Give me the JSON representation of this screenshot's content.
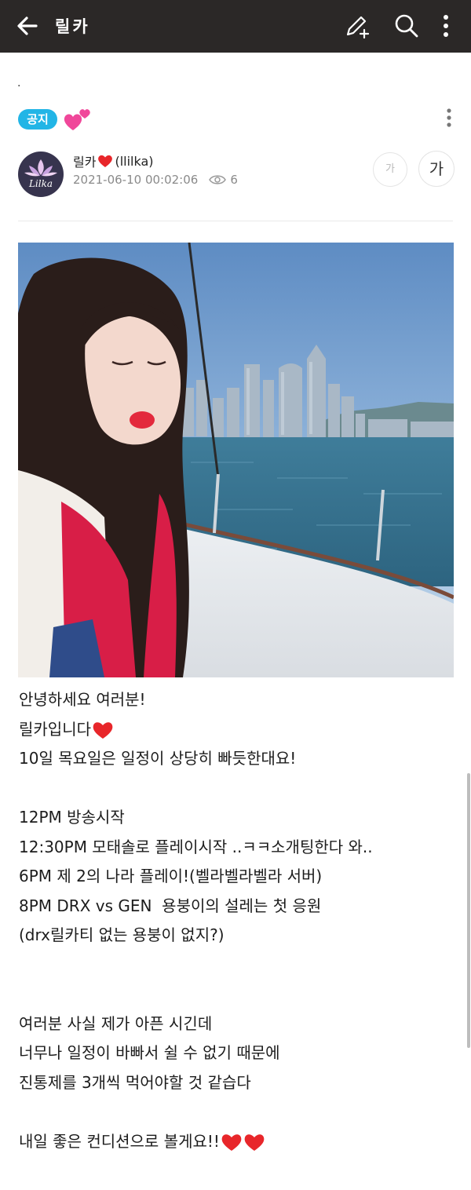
{
  "app_bar": {
    "title": "릴카",
    "icons": [
      "back-arrow-icon",
      "write-icon",
      "search-icon",
      "more-vertical-icon"
    ],
    "background": "#2b2827"
  },
  "post": {
    "top_dot": ".",
    "badge": "공지",
    "badge_color": "#22b5e6",
    "badge_emoji": "two-hearts-icon",
    "author": {
      "name": "릴카",
      "handle": "(llilka)",
      "avatar_text": "Lilka"
    },
    "date": "2021-06-10 00:02:06",
    "views": "6",
    "font_small": "가",
    "font_large": "가"
  },
  "content": {
    "lines": [
      "안녕하세요 여러분!",
      "릴카입니다",
      "10일 목요일은 일정이 상당히 빠듯한대요!",
      "",
      "12PM 방송시작",
      "12:30PM 모태솔로 플레이시작 ..ㅋㅋ소개팅한다 와..",
      "6PM 제 2의 나라 플레이!(벨라벨라벨라 서버)",
      "8PM DRX vs GEN  용붕이의 설레는 첫 응원",
      "(drx릴카티 없는 용붕이 없지?)",
      "",
      "",
      "여러분 사실 제가 아픈 시긴데",
      "너무나 일정이 바빠서 쉴 수 없기 때문에",
      "진통제를 3개씩 먹어야할 것 같습다",
      "",
      "내일 좋은 컨디션으로 볼게요!!"
    ],
    "heart_color": "#e8262a"
  }
}
